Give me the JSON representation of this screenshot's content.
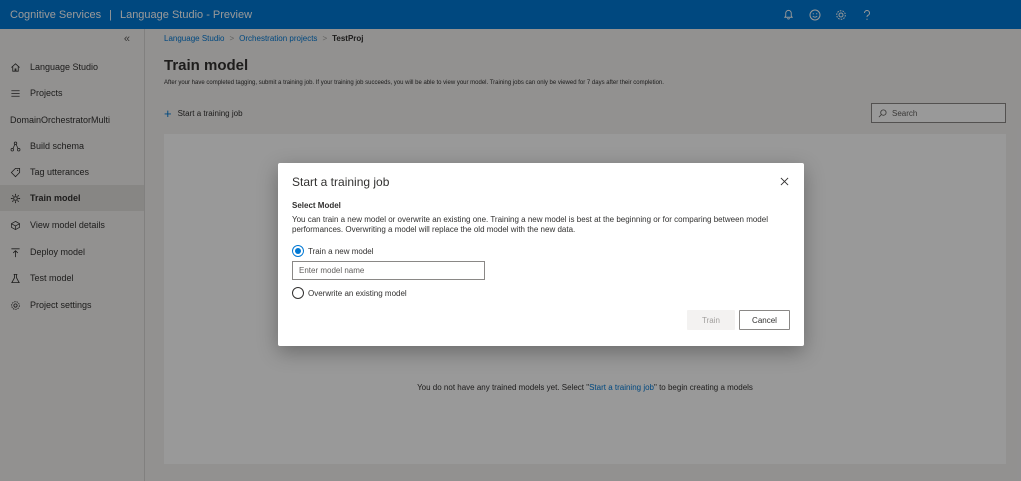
{
  "topbar": {
    "brand": "Cognitive Services",
    "separator": "|",
    "product": "Language Studio - Preview"
  },
  "sidebar": {
    "collapse_glyph": "«",
    "top_items": [
      {
        "label": "Language Studio",
        "icon": "home-icon"
      },
      {
        "label": "Projects",
        "icon": "list-icon"
      }
    ],
    "project_name": "DomainOrchestratorMulti",
    "project_items": [
      {
        "label": "Build schema",
        "icon": "schema-icon"
      },
      {
        "label": "Tag utterances",
        "icon": "tag-icon"
      },
      {
        "label": "Train model",
        "icon": "train-icon"
      },
      {
        "label": "View model details",
        "icon": "model-icon"
      },
      {
        "label": "Deploy model",
        "icon": "deploy-icon"
      },
      {
        "label": "Test model",
        "icon": "test-icon"
      },
      {
        "label": "Project settings",
        "icon": "settings-icon"
      }
    ]
  },
  "breadcrumb": {
    "items": [
      "Language Studio",
      "Orchestration projects"
    ],
    "separator": ">",
    "current": "TestProj"
  },
  "page": {
    "title": "Train model",
    "description": "After your have completed tagging, submit a training job. If your training job succeeds, you will be able to view your model. Training jobs can only be viewed for 7 days after their completion.",
    "start_job_label": "Start a training job",
    "search_placeholder": "Search",
    "empty_before": "You do not have any trained models yet. Select \"",
    "empty_link": "Start a training job",
    "empty_after": "\" to begin creating a models"
  },
  "dialog": {
    "title": "Start a training job",
    "section_label": "Select Model",
    "section_desc": "You can train a new model or overwrite an existing one. Training a new model is best at the beginning or for comparing between model performances. Overwriting a model will replace the old model with the new data.",
    "option_new": "Train a new model",
    "option_overwrite": "Overwrite an existing model",
    "model_name_placeholder": "Enter model name",
    "model_name_value": "",
    "train_label": "Train",
    "cancel_label": "Cancel"
  },
  "colors": {
    "brand": "#0078d4",
    "sidebar_bg": "#f3f2f1",
    "selected_bg": "#e1dfdd"
  }
}
